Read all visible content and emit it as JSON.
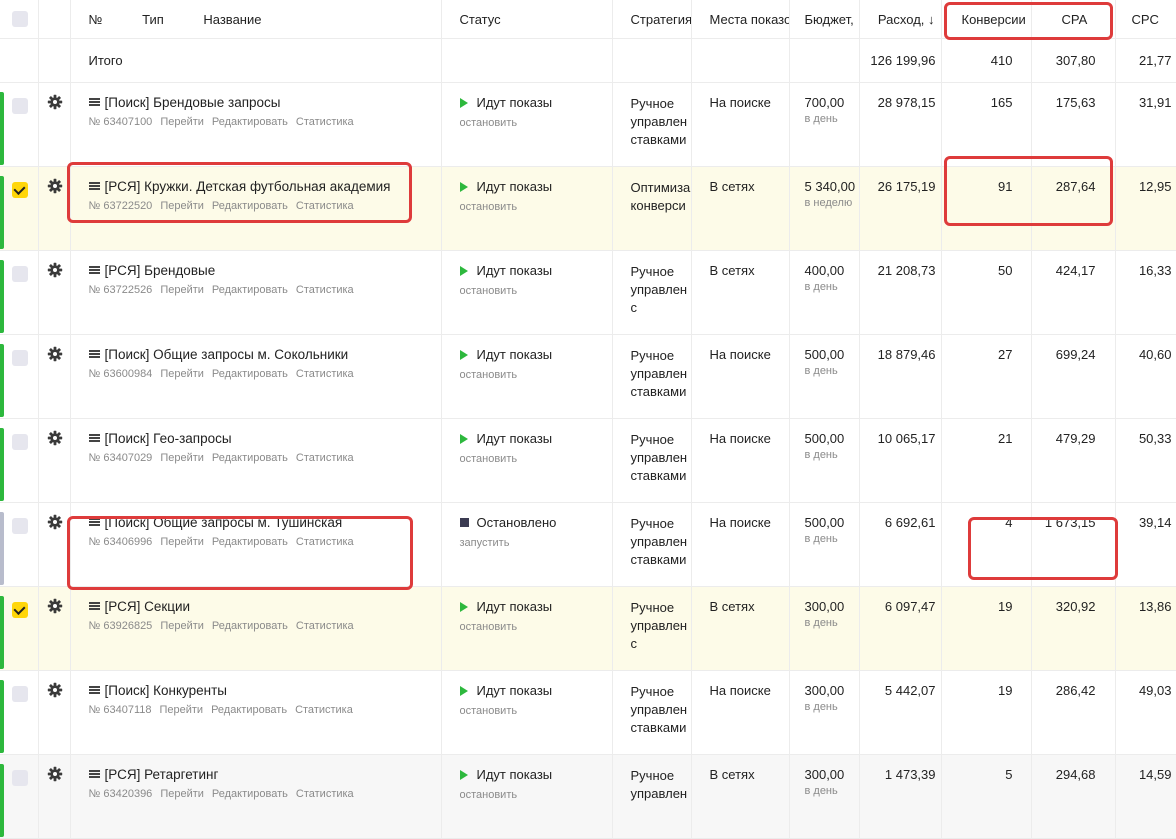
{
  "header": {
    "num": "№",
    "type": "Тип",
    "name": "Название",
    "status": "Статус",
    "strategy": "Стратегия",
    "places": "Места показов",
    "budget": "Бюджет,",
    "spend": "Расход, ↓",
    "conversions": "Конверсии",
    "cpa": "CPA",
    "cpc": "CPC"
  },
  "totals": {
    "label": "Итого",
    "spend": "126 199,96",
    "conversions": "410",
    "cpa": "307,80",
    "cpc": "21,77"
  },
  "row_actions": {
    "go": "Перейти",
    "edit": "Редактировать",
    "stats": "Статистика"
  },
  "colors": {
    "active_stripe": "#2db83d",
    "stopped_stripe": "#b8bccc",
    "checkbox_checked": "#ffd60a",
    "highlight": "#de3b3b"
  },
  "rows": [
    {
      "title": "[Поиск] Брендовые запросы",
      "id": "№ 63407100",
      "status": "Идут показы",
      "status_action": "остановить",
      "strategy": [
        "Ручное",
        "управлен",
        "ставками"
      ],
      "places": "На поиске",
      "budget": "700,00",
      "budget_period": "в день",
      "spend": "28 978,15",
      "conversions": "165",
      "cpa": "175,63",
      "cpc": "31,91"
    },
    {
      "title": "[РСЯ] Кружки. Детская футбольная академия",
      "id": "№ 63722520",
      "status": "Идут показы",
      "status_action": "остановить",
      "strategy": [
        "Оптимиза",
        "конверси",
        ""
      ],
      "places": "В сетях",
      "budget": "5 340,00",
      "budget_period": "в неделю",
      "spend": "26 175,19",
      "conversions": "91",
      "cpa": "287,64",
      "cpc": "12,95"
    },
    {
      "title": "[РСЯ] Брендовые",
      "id": "№ 63722526",
      "status": "Идут показы",
      "status_action": "остановить",
      "strategy": [
        "Ручное",
        "управлен",
        "с"
      ],
      "places": "В сетях",
      "budget": "400,00",
      "budget_period": "в день",
      "spend": "21 208,73",
      "conversions": "50",
      "cpa": "424,17",
      "cpc": "16,33"
    },
    {
      "title": "[Поиск] Общие запросы м. Сокольники",
      "id": "№ 63600984",
      "status": "Идут показы",
      "status_action": "остановить",
      "strategy": [
        "Ручное",
        "управлен",
        "ставками"
      ],
      "places": "На поиске",
      "budget": "500,00",
      "budget_period": "в день",
      "spend": "18 879,46",
      "conversions": "27",
      "cpa": "699,24",
      "cpc": "40,60"
    },
    {
      "title": "[Поиск] Гео-запросы",
      "id": "№ 63407029",
      "status": "Идут показы",
      "status_action": "остановить",
      "strategy": [
        "Ручное",
        "управлен",
        "ставками"
      ],
      "places": "На поиске",
      "budget": "500,00",
      "budget_period": "в день",
      "spend": "10 065,17",
      "conversions": "21",
      "cpa": "479,29",
      "cpc": "50,33"
    },
    {
      "title": "[Поиск] Общие запросы м. Тушинская",
      "id": "№ 63406996",
      "status": "Остановлено",
      "status_action": "запустить",
      "strategy": [
        "Ручное",
        "управлен",
        "ставками"
      ],
      "places": "На поиске",
      "budget": "500,00",
      "budget_period": "в день",
      "spend": "6 692,61",
      "conversions": "4",
      "cpa": "1 673,15",
      "cpc": "39,14"
    },
    {
      "title": "[РСЯ] Секции",
      "id": "№ 63926825",
      "status": "Идут показы",
      "status_action": "остановить",
      "strategy": [
        "Ручное",
        "управлен",
        "с"
      ],
      "places": "В сетях",
      "budget": "300,00",
      "budget_period": "в день",
      "spend": "6 097,47",
      "conversions": "19",
      "cpa": "320,92",
      "cpc": "13,86"
    },
    {
      "title": "[Поиск] Конкуренты",
      "id": "№ 63407118",
      "status": "Идут показы",
      "status_action": "остановить",
      "strategy": [
        "Ручное",
        "управлен",
        "ставками"
      ],
      "places": "На поиске",
      "budget": "300,00",
      "budget_period": "в день",
      "spend": "5 442,07",
      "conversions": "19",
      "cpa": "286,42",
      "cpc": "49,03"
    },
    {
      "title": "[РСЯ] Ретаргетинг",
      "id": "№ 63420396",
      "status": "Идут показы",
      "status_action": "остановить",
      "strategy": [
        "Ручное",
        "управлен",
        ""
      ],
      "places": "В сетях",
      "budget": "300,00",
      "budget_period": "в день",
      "spend": "1 473,39",
      "conversions": "5",
      "cpa": "294,68",
      "cpc": "14,59"
    }
  ]
}
